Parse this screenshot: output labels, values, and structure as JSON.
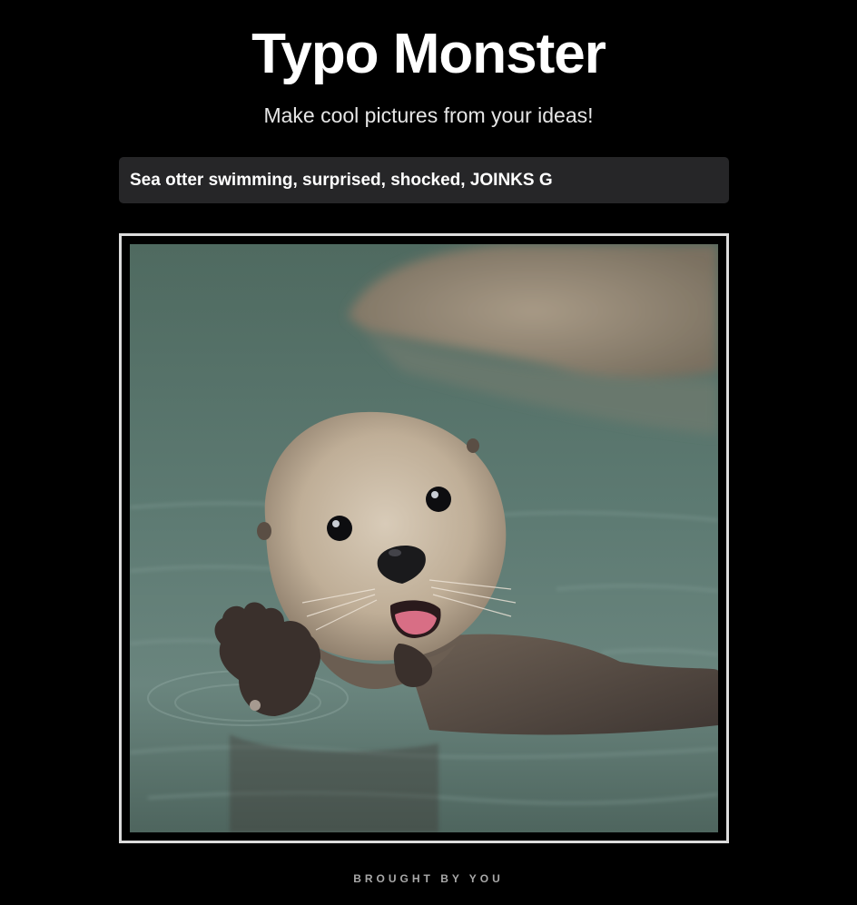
{
  "header": {
    "title": "Typo Monster",
    "subtitle": "Make cool pictures from your ideas!"
  },
  "prompt": {
    "value": "Sea otter swimming, surprised, shocked, JOINKS G"
  },
  "image": {
    "alt": "Sea otter swimming, surprised, shocked, JOINKS G"
  },
  "footer": {
    "text": "BROUGHT BY YOU"
  }
}
